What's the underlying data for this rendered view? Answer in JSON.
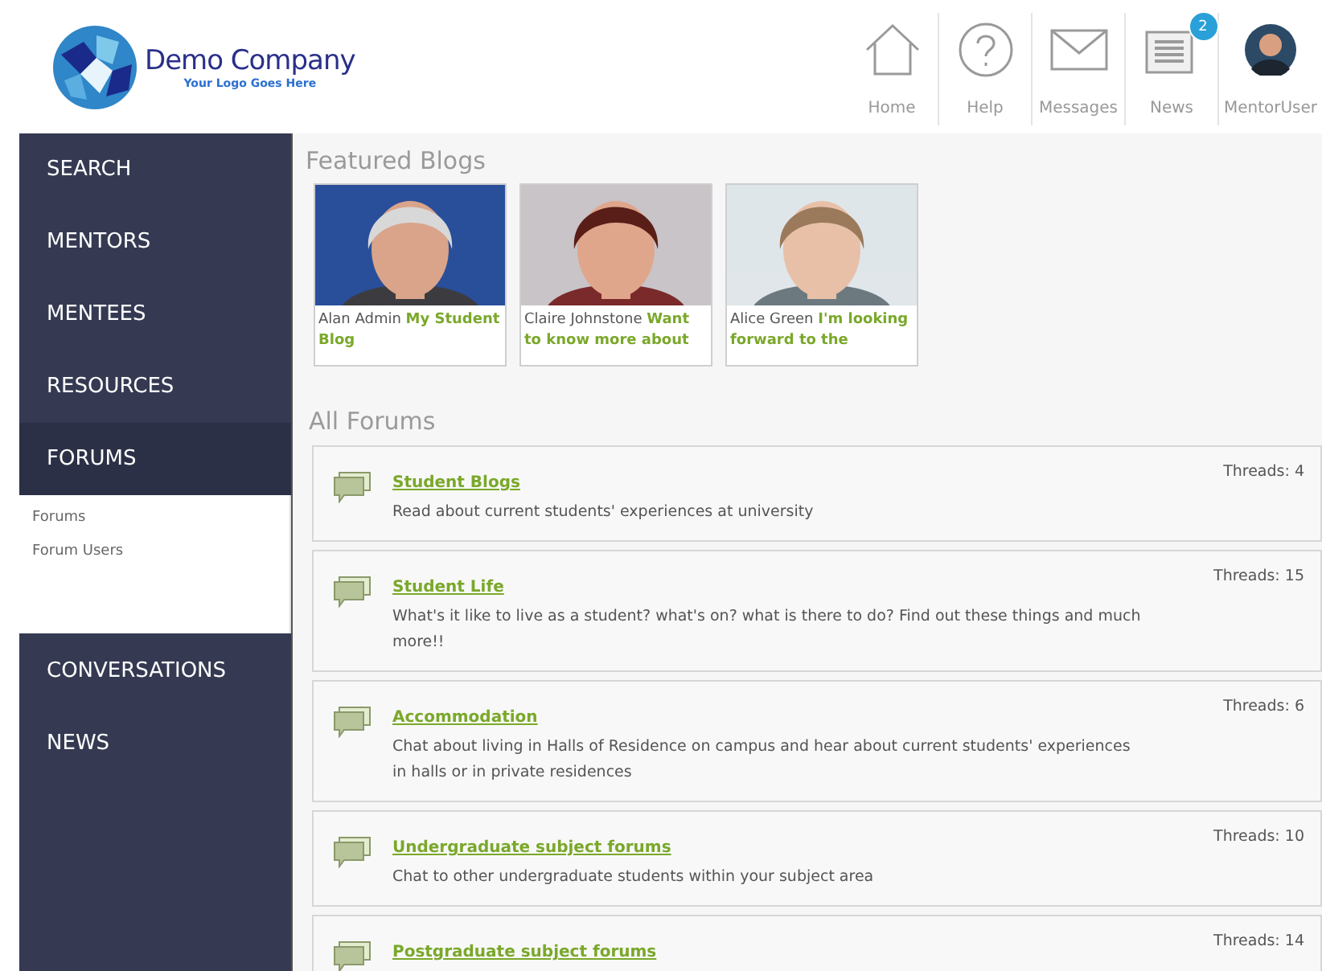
{
  "logo": {
    "name": "Demo Company",
    "tagline": "Your Logo Goes Here"
  },
  "nav": [
    {
      "label": "Home",
      "kind": "home"
    },
    {
      "label": "Help",
      "kind": "help"
    },
    {
      "label": "Messages",
      "kind": "mail"
    },
    {
      "label": "News",
      "kind": "news",
      "badge": "2"
    },
    {
      "label": "MentorUser",
      "kind": "avatar"
    }
  ],
  "sidebar": {
    "items": [
      {
        "label": "SEARCH",
        "expanded": false
      },
      {
        "label": "MENTORS",
        "expanded": false
      },
      {
        "label": "MENTEES",
        "expanded": false
      },
      {
        "label": "RESOURCES",
        "expanded": false
      },
      {
        "label": "FORUMS",
        "expanded": true,
        "children": [
          {
            "label": "Forums"
          },
          {
            "label": "Forum Users"
          }
        ]
      },
      {
        "label": "CONVERSATIONS",
        "expanded": false
      },
      {
        "label": "NEWS",
        "expanded": false
      }
    ]
  },
  "featured_blogs": {
    "title": "Featured Blogs",
    "items": [
      {
        "author": "Alan Admin",
        "title": "My Student Blog",
        "kind": "picture"
      },
      {
        "author": "Claire Johnstone",
        "title": "Want to know more about",
        "kind": "picture"
      },
      {
        "author": "Alice Green",
        "title": "I'm looking forward to the",
        "kind": "picture"
      }
    ]
  },
  "forums": {
    "title": "All Forums",
    "items": [
      {
        "name": "Student Blogs",
        "description": "Read about current students' experiences at university",
        "threads": "Threads: 4"
      },
      {
        "name": "Student Life",
        "description": "What's it like to live as a student? what's on? what is there to do? Find out these things and much more!!",
        "threads": "Threads: 15"
      },
      {
        "name": "Accommodation",
        "description": "Chat about living in Halls of Residence on campus and hear about current students' experiences in halls or in private residences",
        "threads": "Threads: 6"
      },
      {
        "name": "Undergraduate subject forums",
        "description": "Chat to other undergraduate students within your subject area",
        "threads": "Threads: 10"
      },
      {
        "name": "Postgraduate subject forums",
        "threads": "Threads: 14"
      }
    ]
  }
}
